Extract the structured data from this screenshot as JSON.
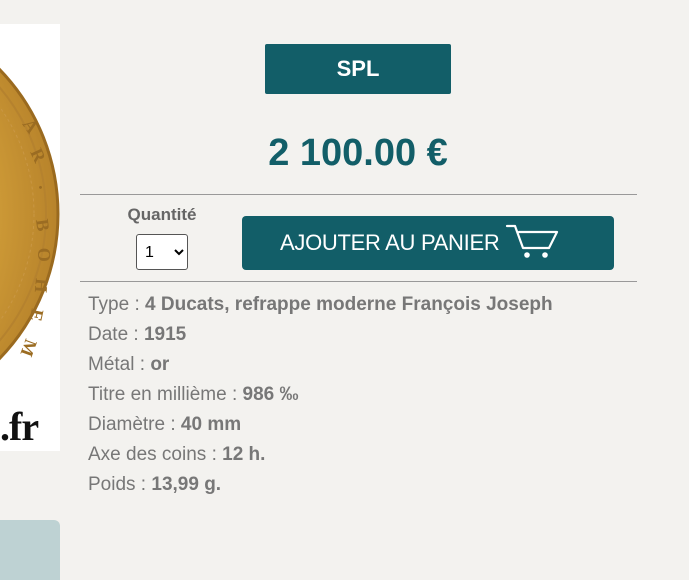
{
  "product": {
    "coin_image": {
      "alt": "coin-photo",
      "legend_text": "AR·BOHEM",
      "site_fragment": ".fr"
    },
    "grade": "SPL",
    "price": "2 100.00 €",
    "quantity": {
      "label": "Quantité",
      "selected": "1",
      "options": [
        "1"
      ]
    },
    "add_to_cart": {
      "label": "AJOUTER AU PANIER",
      "icon": "cart-icon"
    },
    "specs": [
      {
        "label": "Type",
        "value": "4 Ducats, refrappe moderne François Joseph"
      },
      {
        "label": "Date",
        "value": "1915"
      },
      {
        "label": "Métal",
        "value": "or"
      },
      {
        "label": "Titre en millième",
        "value": "986 ‰"
      },
      {
        "label": "Diamètre",
        "value": "40 mm"
      },
      {
        "label": "Axe des coins",
        "value": "12 h."
      },
      {
        "label": "Poids",
        "value": "13,99 g."
      }
    ]
  },
  "colors": {
    "accent": "#125e68",
    "page_bg": "#f3f2ef",
    "text_muted": "#777777"
  }
}
